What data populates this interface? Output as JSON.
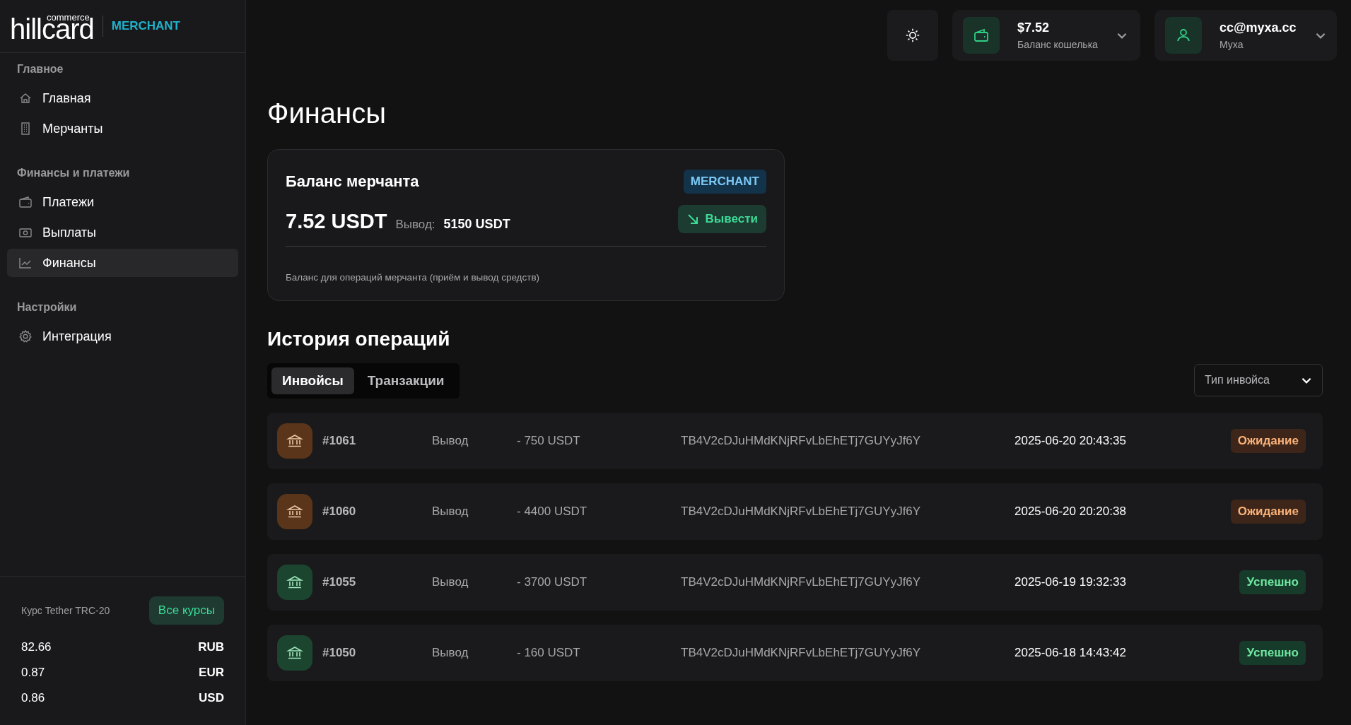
{
  "brand": {
    "wordmark": "hillcard",
    "tagline": "commerce",
    "badge": "MERCHANT"
  },
  "sidebar": {
    "sections": [
      {
        "title": "Главное",
        "items": [
          {
            "label": "Главная",
            "kind": "home",
            "selected": false
          },
          {
            "label": "Мерчанты",
            "kind": "building",
            "selected": false
          }
        ]
      },
      {
        "title": "Финансы и платежи",
        "items": [
          {
            "label": "Платежи",
            "kind": "wallet",
            "selected": false
          },
          {
            "label": "Выплаты",
            "kind": "cash",
            "selected": false
          },
          {
            "label": "Финансы",
            "kind": "chart",
            "selected": true
          }
        ]
      },
      {
        "title": "Настройки",
        "items": [
          {
            "label": "Интеграция",
            "kind": "gear",
            "selected": false
          }
        ]
      }
    ],
    "rates": {
      "title": "Курс Tether TRC-20",
      "button": "Все курсы",
      "rows": [
        {
          "value": "82.66",
          "currency": "RUB"
        },
        {
          "value": "0.87",
          "currency": "EUR"
        },
        {
          "value": "0.86",
          "currency": "USD"
        }
      ]
    }
  },
  "header": {
    "wallet": {
      "amount": "$7.52",
      "label": "Баланс кошелька"
    },
    "user": {
      "email": "cc@myxa.cc",
      "name": "Муха"
    }
  },
  "page_title": "Финансы",
  "balance_card": {
    "title": "Баланс мерчанта",
    "badge": "MERCHANT",
    "amount": "7.52 USDT",
    "withdraw_label": "Вывод:",
    "withdraw_amount": "5150 USDT",
    "button": "Вывести",
    "note": "Баланс для операций мерчанта (приём и вывод средств)"
  },
  "history": {
    "title": "История операций",
    "tabs": [
      {
        "label": "Инвойсы",
        "selected": true
      },
      {
        "label": "Транзакции",
        "selected": false
      }
    ],
    "filter": {
      "placeholder": "Тип инвойса"
    },
    "rows": [
      {
        "id": "#1061",
        "type": "Вывод",
        "amount": "- 750 USDT",
        "address": "TB4V2cDJuHMdKNjRFvLbEhETj7GUYyJf6Y",
        "date": "2025-06-20 20:43:35",
        "status": "Ожидание",
        "kind": "pending"
      },
      {
        "id": "#1060",
        "type": "Вывод",
        "amount": "- 4400 USDT",
        "address": "TB4V2cDJuHMdKNjRFvLbEhETj7GUYyJf6Y",
        "date": "2025-06-20 20:20:38",
        "status": "Ожидание",
        "kind": "pending"
      },
      {
        "id": "#1055",
        "type": "Вывод",
        "amount": "- 3700 USDT",
        "address": "TB4V2cDJuHMdKNjRFvLbEhETj7GUYyJf6Y",
        "date": "2025-06-19 19:32:33",
        "status": "Успешно",
        "kind": "success"
      },
      {
        "id": "#1050",
        "type": "Вывод",
        "amount": "- 160 USDT",
        "address": "TB4V2cDJuHMdKNjRFvLbEhETj7GUYyJf6Y",
        "date": "2025-06-18 14:43:42",
        "status": "Успешно",
        "kind": "success"
      }
    ]
  }
}
